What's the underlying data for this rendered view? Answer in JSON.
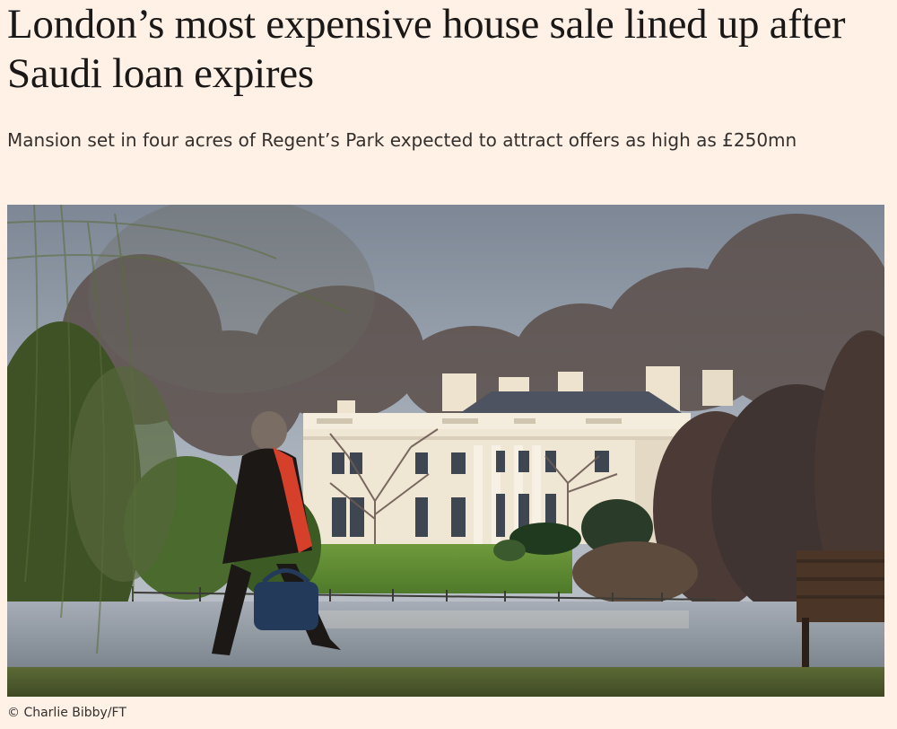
{
  "article": {
    "headline": "London’s most expensive house sale lined up after Saudi loan expires",
    "standfirst": "Mansion set in four acres of Regent’s Park expected to attract offers as high as £250mn",
    "image_credit": "© Charlie Bibby/FT"
  },
  "colors": {
    "page_background": "#fff1e5",
    "headline_text": "#1a1817",
    "body_text": "#33302e"
  }
}
